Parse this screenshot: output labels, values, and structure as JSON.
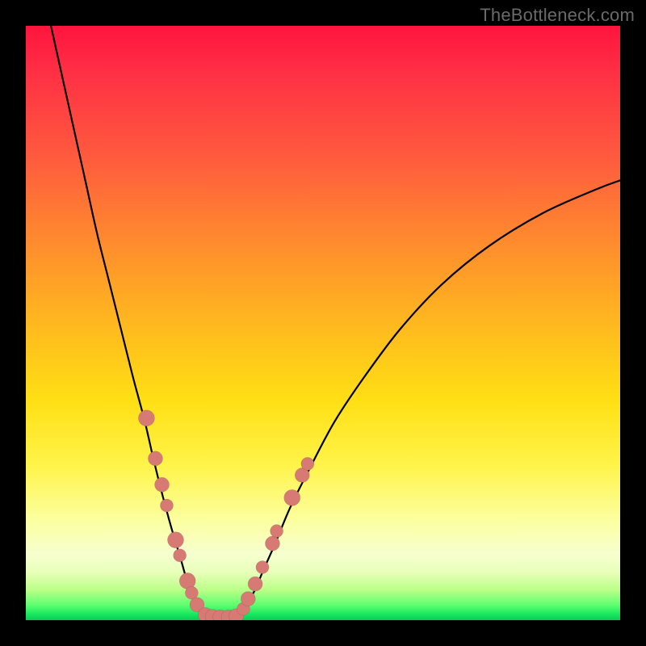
{
  "watermark": "TheBottleneck.com",
  "chart_data": {
    "type": "line",
    "title": "",
    "xlabel": "",
    "ylabel": "",
    "xlim": [
      0,
      100
    ],
    "ylim": [
      0,
      100
    ],
    "left_curve": {
      "name": "left-branch",
      "x": [
        4,
        6,
        8,
        10,
        12,
        14,
        16,
        18,
        20,
        21.5,
        23,
        24.5,
        26,
        27,
        28,
        29,
        30
      ],
      "y": [
        101,
        92,
        83,
        74,
        65,
        57,
        49,
        41,
        33.5,
        27,
        21,
        15.5,
        10.5,
        7,
        4,
        2,
        1
      ]
    },
    "right_curve": {
      "name": "right-branch",
      "x": [
        36,
        37,
        38.5,
        40,
        42,
        44.5,
        48,
        52,
        57,
        63,
        70,
        78,
        87,
        96,
        100
      ],
      "y": [
        1,
        2.5,
        5,
        8.5,
        13,
        19,
        26,
        33.5,
        41,
        49,
        56.5,
        63,
        68.5,
        72.5,
        74
      ]
    },
    "valley": {
      "x": [
        30,
        31,
        32,
        33,
        34,
        35,
        36
      ],
      "y": [
        1,
        0.6,
        0.5,
        0.5,
        0.5,
        0.6,
        1
      ]
    },
    "dots_left_branch": [
      {
        "x": 20.3,
        "y": 34,
        "r": 10
      },
      {
        "x": 21.8,
        "y": 27.2,
        "r": 9
      },
      {
        "x": 22.9,
        "y": 22.8,
        "r": 9
      },
      {
        "x": 23.7,
        "y": 19.3,
        "r": 8
      },
      {
        "x": 25.2,
        "y": 13.5,
        "r": 10
      },
      {
        "x": 25.9,
        "y": 10.9,
        "r": 8
      },
      {
        "x": 27.2,
        "y": 6.6,
        "r": 10
      },
      {
        "x": 27.9,
        "y": 4.6,
        "r": 8
      },
      {
        "x": 28.8,
        "y": 2.6,
        "r": 9
      }
    ],
    "dots_valley": [
      {
        "x": 30.2,
        "y": 0.9,
        "r": 9
      },
      {
        "x": 31.4,
        "y": 0.6,
        "r": 9
      },
      {
        "x": 32.7,
        "y": 0.5,
        "r": 9
      },
      {
        "x": 34.1,
        "y": 0.5,
        "r": 9
      },
      {
        "x": 35.4,
        "y": 0.7,
        "r": 9
      }
    ],
    "dots_right_branch": [
      {
        "x": 36.6,
        "y": 1.9,
        "r": 8
      },
      {
        "x": 37.4,
        "y": 3.6,
        "r": 9
      },
      {
        "x": 38.6,
        "y": 6.1,
        "r": 9
      },
      {
        "x": 39.8,
        "y": 8.9,
        "r": 8
      },
      {
        "x": 41.5,
        "y": 12.9,
        "r": 9
      },
      {
        "x": 42.2,
        "y": 15.0,
        "r": 8
      },
      {
        "x": 44.8,
        "y": 20.6,
        "r": 10
      },
      {
        "x": 46.5,
        "y": 24.4,
        "r": 9
      },
      {
        "x": 47.4,
        "y": 26.3,
        "r": 8
      }
    ]
  }
}
